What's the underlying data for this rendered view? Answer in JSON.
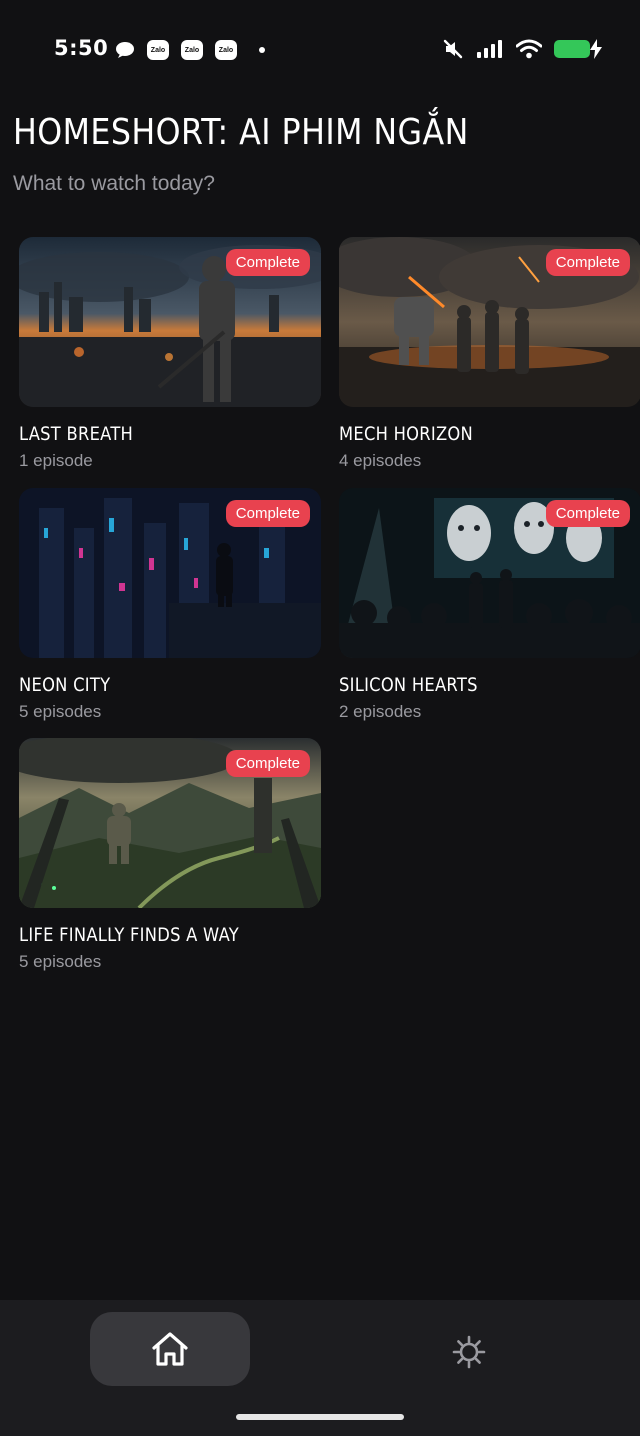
{
  "status_bar": {
    "time": "5:50",
    "zalo_label": "Zalo",
    "icons": [
      "chat-bubble-icon",
      "zalo-icon",
      "zalo-icon",
      "zalo-icon",
      "dot-icon",
      "mute-icon",
      "signal-icon",
      "wifi-icon",
      "battery-charging-icon"
    ],
    "battery_color": "#34c759"
  },
  "header": {
    "title": "HOMESHORT: AI PHIM NGẮN",
    "subtitle": "What to watch today?"
  },
  "shows": [
    {
      "title": "LAST BREATH",
      "episodes": "1 episode",
      "badge": "Complete"
    },
    {
      "title": "MECH HORIZON",
      "episodes": "4 episodes",
      "badge": "Complete"
    },
    {
      "title": "NEON CITY",
      "episodes": "5 episodes",
      "badge": "Complete"
    },
    {
      "title": "SILICON HEARTS",
      "episodes": "2 episodes",
      "badge": "Complete"
    },
    {
      "title": "LIFE FINALLY FINDS A WAY",
      "episodes": "5 episodes",
      "badge": "Complete"
    }
  ],
  "bottom_nav": {
    "items": [
      {
        "icon": "home-icon",
        "active": true
      },
      {
        "icon": "settings-gear-icon",
        "active": false
      }
    ]
  },
  "colors": {
    "background": "#111113",
    "badge": "#e8424f",
    "nav_background": "#1c1c1f",
    "nav_active": "#38383c"
  }
}
